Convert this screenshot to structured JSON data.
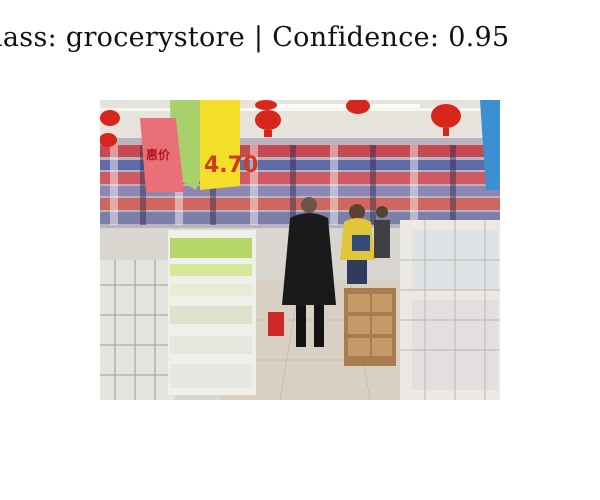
{
  "header": {
    "class_prefix": "Class: ",
    "class_label": "grocerystore",
    "separator": " | ",
    "confidence_prefix": "Confidence: ",
    "confidence_value": "0.95"
  },
  "photo": {
    "sign_text": "4.70",
    "sign_small_text": "惠价",
    "colors": {
      "ceiling": "#e8e6e0",
      "floor": "#d8cfbf",
      "lantern": "#d8261c",
      "sign_yellow": "#f3df2a",
      "sign_red": "#d43a1a"
    }
  }
}
